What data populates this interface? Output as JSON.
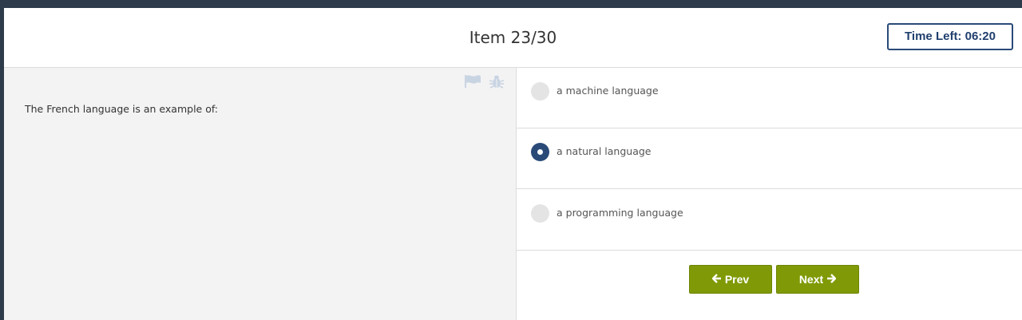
{
  "header": {
    "item_counter": "Item 23/30",
    "time_left": "Time Left: 06:20"
  },
  "question": {
    "text": "The French language is an example of:",
    "tools": [
      {
        "icon": "flag-icon"
      },
      {
        "icon": "bug-icon"
      }
    ]
  },
  "options": [
    {
      "label": "a machine language",
      "selected": false
    },
    {
      "label": "a natural language",
      "selected": true
    },
    {
      "label": "a programming language",
      "selected": false
    }
  ],
  "navigation": {
    "prev_label": "Prev",
    "prev_icon": "arrow-left-icon",
    "next_label": "Next",
    "next_icon": "arrow-right-icon"
  },
  "colors": {
    "accent": "#2a4a78",
    "button": "#7f9a06",
    "background_top_bar": "#2d3b4a"
  }
}
